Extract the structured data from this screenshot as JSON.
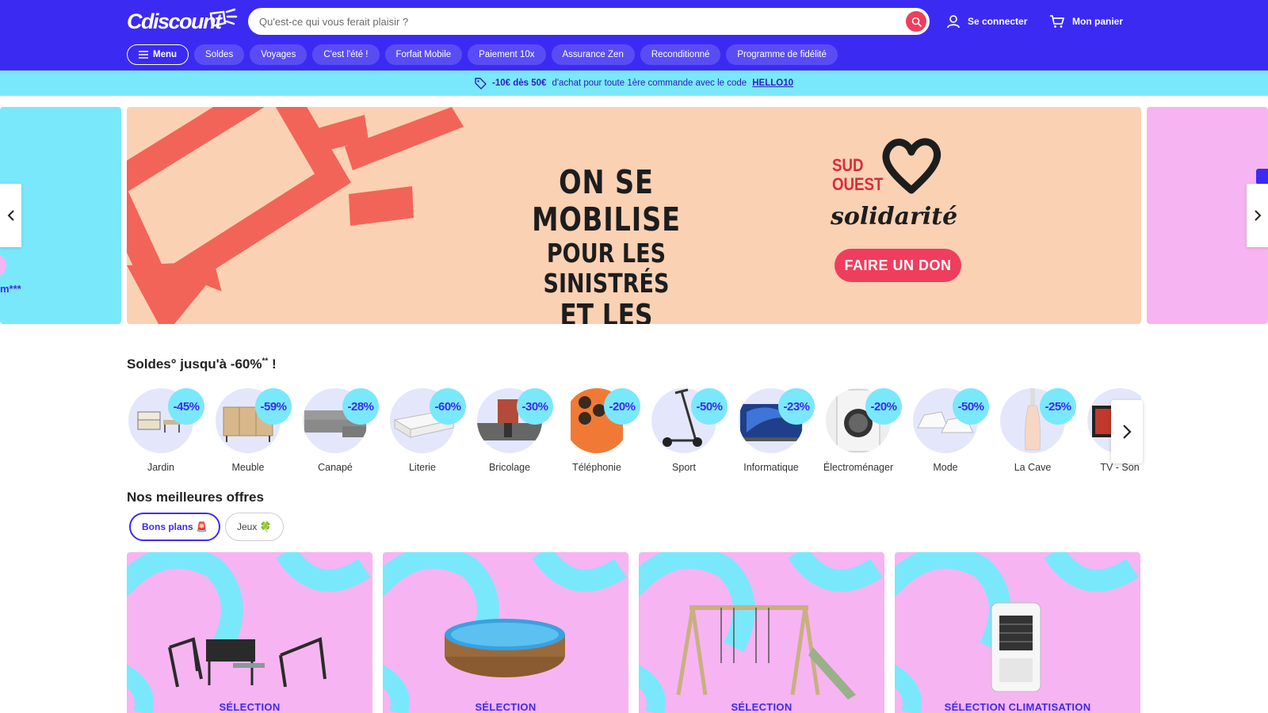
{
  "header": {
    "logo_text": "Cdiscount",
    "search_placeholder": "Qu'est-ce qui vous ferait plaisir ?",
    "login_label": "Se connecter",
    "cart_label": "Mon panier"
  },
  "nav": {
    "menu_label": "Menu",
    "items": [
      "Soldes",
      "Voyages",
      "C'est l'été !",
      "Forfait Mobile",
      "Paiement 10x",
      "Assurance Zen",
      "Reconditionné",
      "Programme de fidélité"
    ]
  },
  "promo": {
    "bold": "-10€ dès 50€",
    "text": "d'achat pour toute 1ère commande avec le code",
    "code": "HELLO10"
  },
  "banner": {
    "line1": "ON SE MOBILISE",
    "line2": "POUR LES SINISTRÉS",
    "line3": "ET LES POMPIERS",
    "brand_sud": "SUD",
    "brand_ouest": "OUEST",
    "brand_solidarite": "solidarité",
    "cta": "FAIRE UN DON",
    "left_peek_text": "m***"
  },
  "soldes": {
    "title_main": "Soldes° jusqu'à -60%",
    "title_sup": "**",
    "title_end": " !",
    "categories": [
      {
        "label": "Jardin",
        "discount": "-45%"
      },
      {
        "label": "Meuble",
        "discount": "-59%"
      },
      {
        "label": "Canapé",
        "discount": "-28%"
      },
      {
        "label": "Literie",
        "discount": "-60%"
      },
      {
        "label": "Bricolage",
        "discount": "-30%"
      },
      {
        "label": "Téléphonie",
        "discount": "-20%"
      },
      {
        "label": "Sport",
        "discount": "-50%"
      },
      {
        "label": "Informatique",
        "discount": "-23%"
      },
      {
        "label": "Électroménager",
        "discount": "-20%"
      },
      {
        "label": "Mode",
        "discount": "-50%"
      },
      {
        "label": "La Cave",
        "discount": "-25%"
      },
      {
        "label": "TV - Son",
        "discount": ""
      }
    ]
  },
  "offers": {
    "title": "Nos meilleures offres",
    "tabs": [
      {
        "label": "Bons plans",
        "emoji": "🚨"
      },
      {
        "label": "Jeux",
        "emoji": "🍀"
      }
    ],
    "cards": [
      "SÉLECTION",
      "SÉLECTION",
      "SÉLECTION",
      "SÉLECTION CLIMATISATION"
    ]
  },
  "colors": {
    "brand_blue": "#3b2bf2",
    "cyan": "#7ae8fb",
    "pink": "#f7b4f2",
    "coral": "#f26457",
    "search_red": "#ef3e5d"
  }
}
